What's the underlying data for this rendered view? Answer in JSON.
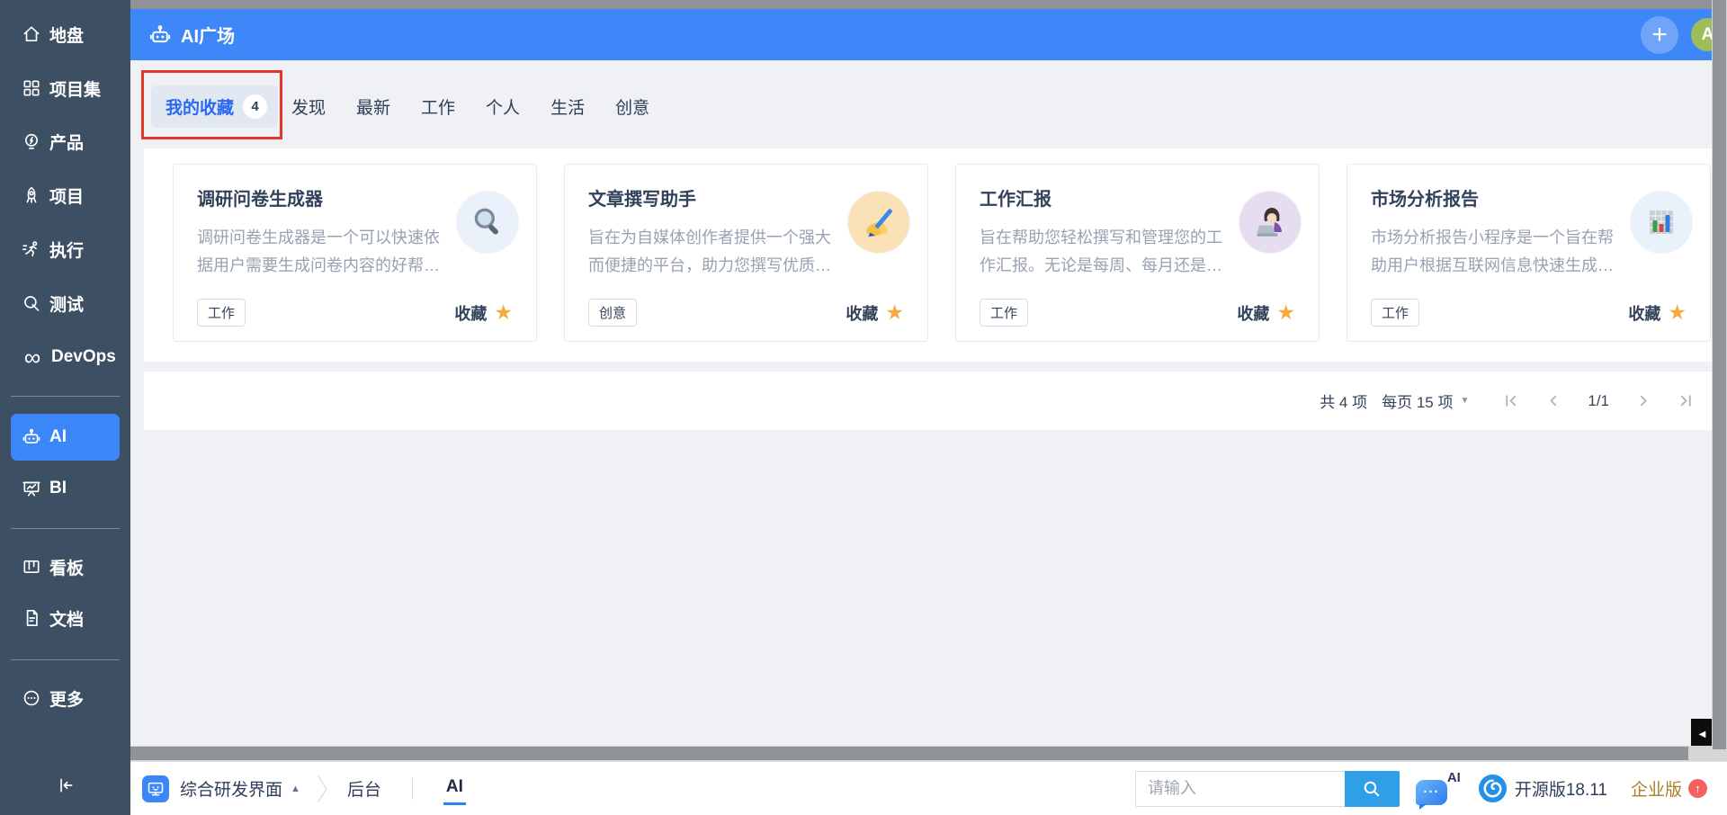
{
  "colors": {
    "header_blue": "#3e87f8",
    "sidebar_dark": "#3c4f63",
    "active_item_blue": "#3c87f8",
    "tab_active_blue": "#2969f2",
    "star_orange": "#f6a93c",
    "annotation_red": "#e13a2c",
    "search_button_blue": "#2f9fe8",
    "upgrade_gold": "#ad7c2c",
    "upgrade_badge_red": "#f56161"
  },
  "sidebar": {
    "items": [
      {
        "label": "地盘",
        "icon": "home-icon"
      },
      {
        "label": "项目集",
        "icon": "project-set-icon"
      },
      {
        "label": "产品",
        "icon": "product-bulb-icon"
      },
      {
        "label": "项目",
        "icon": "rocket-icon"
      },
      {
        "label": "执行",
        "icon": "runner-icon"
      },
      {
        "label": "测试",
        "icon": "magnifier-icon"
      },
      {
        "label": "DevOps",
        "icon": "infinity-icon"
      },
      {
        "label": "AI",
        "icon": "robot-icon",
        "active": true
      },
      {
        "label": "BI",
        "icon": "chart-board-icon"
      },
      {
        "label": "看板",
        "icon": "kanban-icon"
      },
      {
        "label": "文档",
        "icon": "document-icon"
      },
      {
        "label": "更多",
        "icon": "more-ellipsis-icon"
      }
    ],
    "collapse_icon": "collapse-sidebar-icon"
  },
  "header": {
    "title": "AI广场",
    "title_icon": "robot-icon",
    "plus_icon": "plus-icon",
    "avatar_text": "A"
  },
  "tabs": {
    "active": {
      "label": "我的收藏",
      "badge": "4"
    },
    "items": [
      {
        "label": "发现"
      },
      {
        "label": "最新"
      },
      {
        "label": "工作"
      },
      {
        "label": "个人"
      },
      {
        "label": "生活"
      },
      {
        "label": "创意"
      }
    ]
  },
  "cards": [
    {
      "title": "调研问卷生成器",
      "description": "调研问卷生成器是一个可以快速依据用户需要生成问卷内容的好帮…",
      "tag": "工作",
      "favorite_label": "收藏",
      "star_icon": "star-icon",
      "icon": "magnifier-emoji-icon",
      "icon_bg": "#eaf1fb"
    },
    {
      "title": "文章撰写助手",
      "description": "旨在为自媒体创作者提供一个强大而便捷的平台，助力您撰写优质…",
      "tag": "创意",
      "favorite_label": "收藏",
      "star_icon": "star-icon",
      "icon": "writing-hand-emoji-icon",
      "icon_bg": "#fbe2b6"
    },
    {
      "title": "工作汇报",
      "description": "旨在帮助您轻松撰写和管理您的工作汇报。无论是每周、每月还是…",
      "tag": "工作",
      "favorite_label": "收藏",
      "star_icon": "star-icon",
      "icon": "woman-technologist-emoji-icon",
      "icon_bg": "#e7ddf1"
    },
    {
      "title": "市场分析报告",
      "description": "市场分析报告小程序是一个旨在帮助用户根据互联网信息快速生成…",
      "tag": "工作",
      "favorite_label": "收藏",
      "star_icon": "star-icon",
      "icon": "bar-chart-emoji-icon",
      "icon_bg": "#e9f1fa"
    }
  ],
  "pagination": {
    "total": "共 4 项",
    "per_page": "每页 15 项",
    "per_page_caret": "▼",
    "page": "1/1",
    "icons": [
      "first-page-icon",
      "prev-page-icon",
      "next-page-icon",
      "last-page-icon"
    ]
  },
  "panel_toggle": {
    "icon": "collapse-right-icon",
    "glyph": "◀"
  },
  "bottombar": {
    "workspace": "综合研发界面",
    "workspace_icon": "app-window-icon",
    "workspace_caret": "▲",
    "nav_admin": "后台",
    "nav_ai": "AI",
    "search_placeholder": "请输入",
    "search_icon": "search-icon",
    "chat_icon": "ai-chat-bubble-icon",
    "chat_label": "AI",
    "chat_dots": "···",
    "logo_icon": "zentao-logo-icon",
    "version": "开源版18.11",
    "upgrade": "企业版",
    "upgrade_badge_icon": "arrow-up-icon",
    "upgrade_badge_glyph": "↑"
  }
}
